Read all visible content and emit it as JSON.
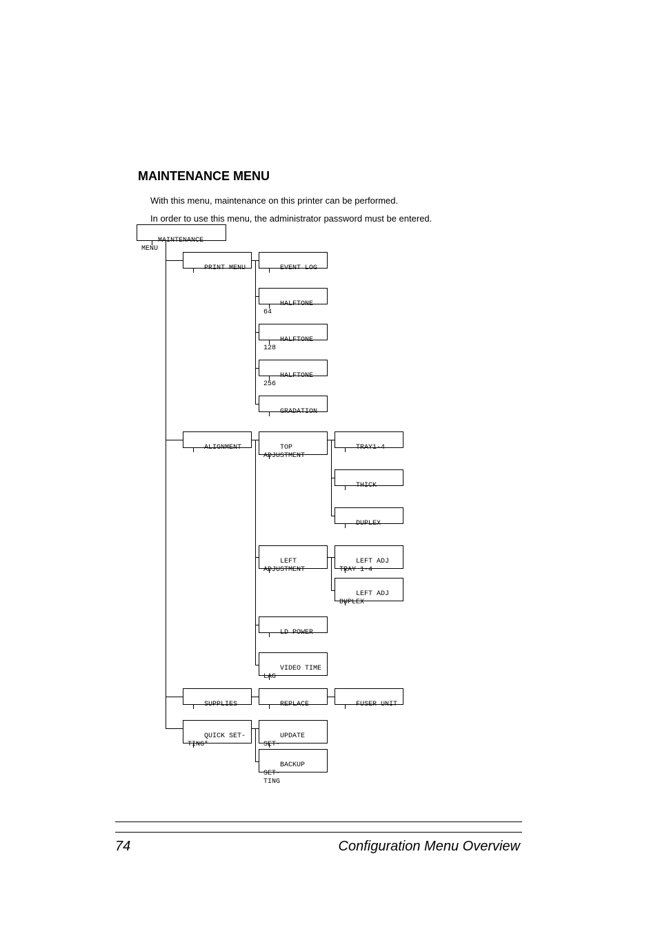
{
  "section": {
    "heading": "MAINTENANCE MENU",
    "intro1": "With this menu, maintenance on this printer can be performed.",
    "intro2": "In order to use this menu, the administrator password must be entered."
  },
  "menu": {
    "root": "MAINTENANCE MENU",
    "level1": {
      "print_menu": "PRINT MENU",
      "alignment": "ALIGNMENT",
      "supplies": "SUPPLIES",
      "quick_setting": "QUICK SET-\nTING*"
    },
    "level2": {
      "event_log": "EVENT LOG",
      "halftone_64": "HALFTONE 64",
      "halftone_128": "HALFTONE 128",
      "halftone_256": "HALFTONE 256",
      "gradation": "GRADATION",
      "top_adjustment": "TOP\nADJUSTMENT",
      "left_adjustment": "LEFT\nADJUSTMENT",
      "ld_power": "LD POWER",
      "video_time_lag": "VIDEO TIME\nLAG",
      "replace": "REPLACE",
      "update_setting": "UPDATE SET-\nTING",
      "backup_setting": "BACKUP SET-\nTING"
    },
    "level3": {
      "tray1_4": "TRAY1-4",
      "thick": "THICK",
      "duplex": "DUPLEX",
      "left_adj_tray": "LEFT ADJ\nTRAY 1-4",
      "left_adj_duplex": "LEFT ADJ\nDUPLEX",
      "fuser_unit": "FUSER UNIT"
    }
  },
  "footer": {
    "page_number": "74",
    "text": "Configuration Menu Overview"
  }
}
